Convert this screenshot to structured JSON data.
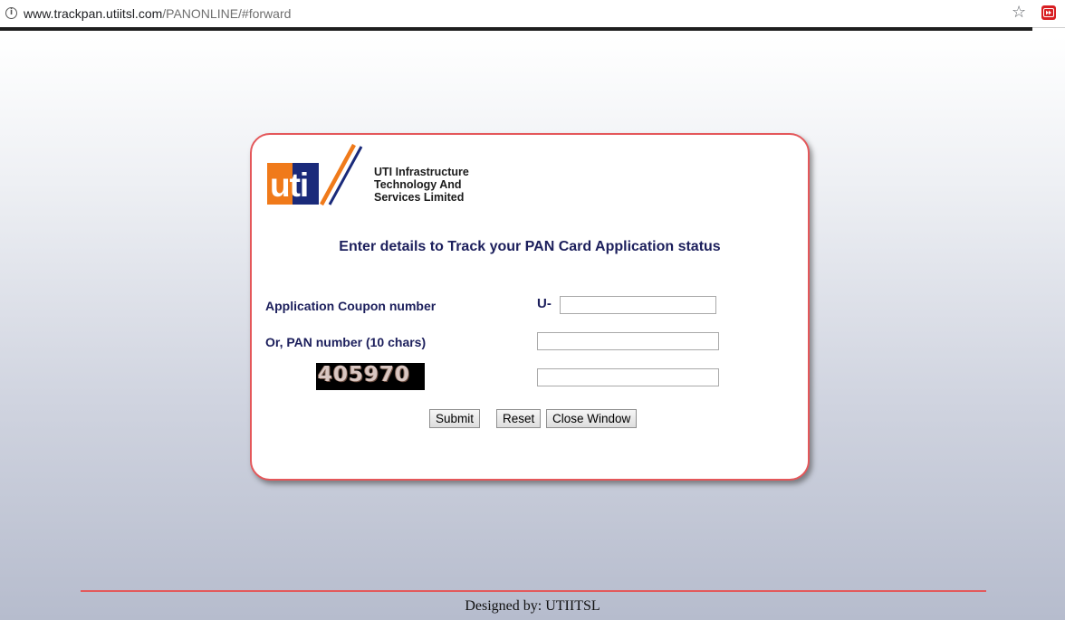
{
  "browser": {
    "url_host": "www.trackpan.utiitsl.com",
    "url_path": "/PANONLINE/#forward",
    "info_icon": "info-icon",
    "bookmark_icon": "star-icon",
    "extension_icon": "extension-icon"
  },
  "logo": {
    "mark": "uti",
    "line1": "UTI Infrastructure",
    "line2": "Technology And",
    "line3": "Services Limited",
    "colors": {
      "orange": "#f07a1a",
      "navy": "#1a2a7a"
    }
  },
  "form": {
    "heading": "Enter details to Track your PAN Card Application status",
    "coupon_label": "Application Coupon number",
    "coupon_prefix": "U-",
    "coupon_value": "",
    "pan_label": "Or, PAN number (10 chars)",
    "pan_value": "",
    "captcha_text": "405970",
    "captcha_value": "",
    "submit_label": "Submit",
    "reset_label": "Reset",
    "close_label": "Close Window"
  },
  "footer": {
    "text": "Designed by: UTIITSL",
    "line_color": "#e35a5c"
  },
  "colors": {
    "card_border": "#e4575a",
    "heading_text": "#1c1f5c"
  }
}
